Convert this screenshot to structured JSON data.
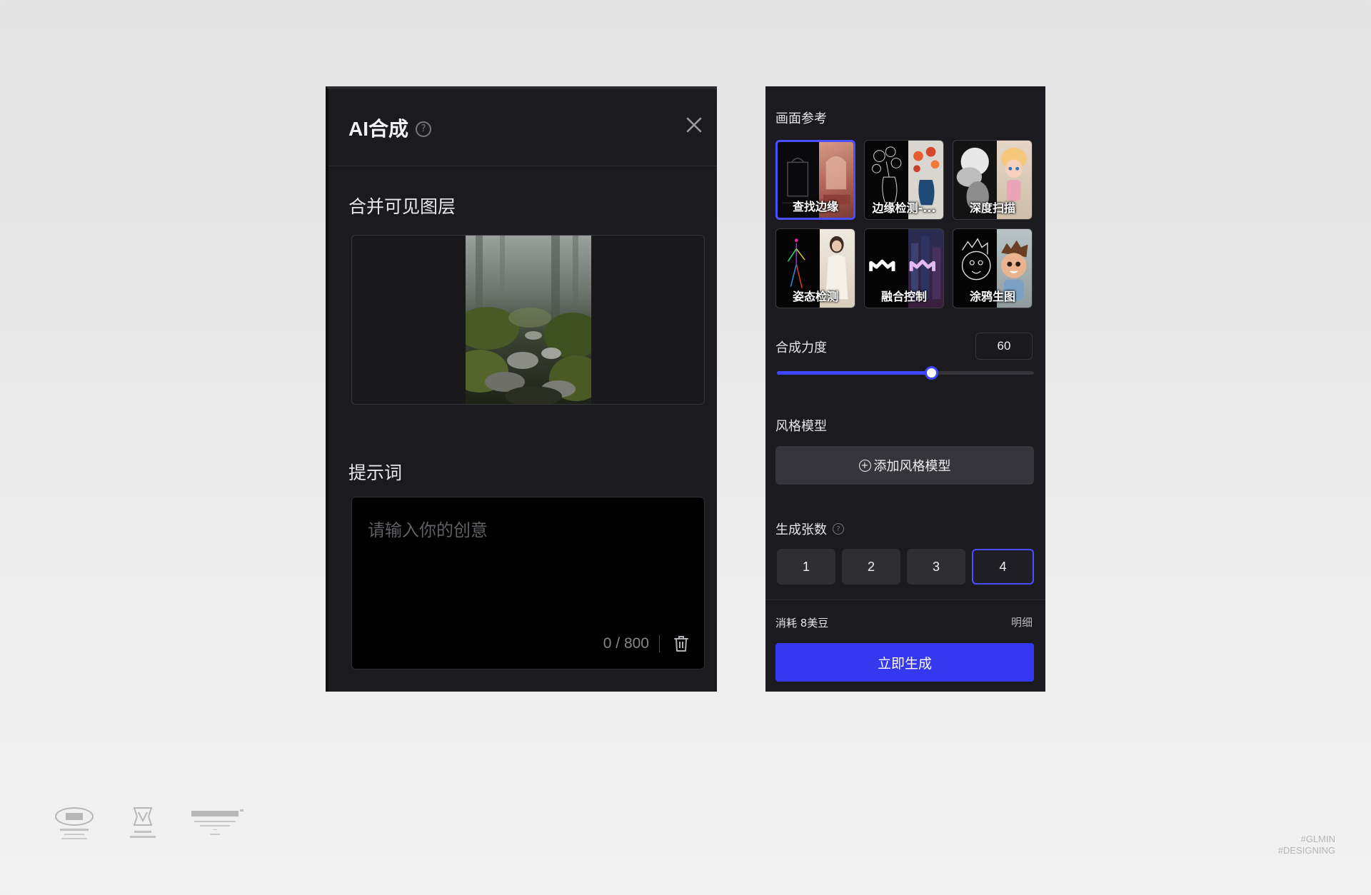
{
  "left_panel": {
    "title": "AI合成",
    "merge_section_title": "合并可见图层",
    "prompt_section_title": "提示词",
    "prompt_placeholder": "请输入你的创意",
    "char_count": "0 / 800"
  },
  "right_panel": {
    "reference_label": "画面参考",
    "references": [
      {
        "label": "查找边缘",
        "selected": true
      },
      {
        "label": "边缘检测-...",
        "selected": false
      },
      {
        "label": "深度扫描",
        "selected": false
      },
      {
        "label": "姿态检测",
        "selected": false
      },
      {
        "label": "融合控制",
        "selected": false
      },
      {
        "label": "涂鸦生图",
        "selected": false
      }
    ],
    "strength_label": "合成力度",
    "strength_value": "60",
    "strength_level": 0.6,
    "style_model_label": "风格模型",
    "add_style_button": "添加风格模型",
    "count_label": "生成张数",
    "count_options": [
      "1",
      "2",
      "3",
      "4"
    ],
    "count_selected": "4",
    "cost_text": "消耗 8美豆",
    "detail_link": "明细",
    "generate_button": "立即生成"
  },
  "footer": {
    "watermark_line1": "#GLMIN",
    "watermark_line2": "#DESIGNING"
  },
  "colors": {
    "accent": "#3438ef",
    "panel_bg": "#1b1b1f",
    "selected_border": "#4a50ff"
  }
}
